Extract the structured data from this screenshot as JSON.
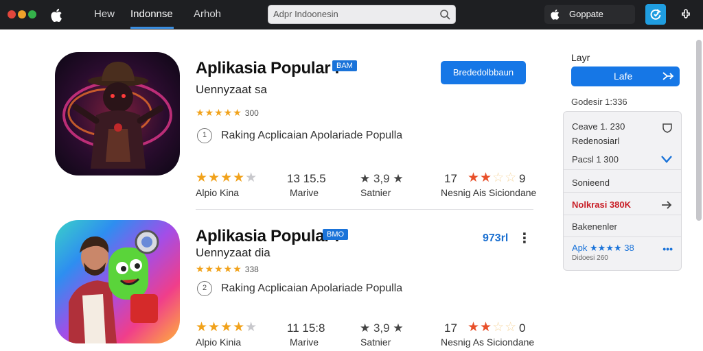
{
  "window": {
    "dots": [
      "#e2463c",
      "#f0a22a",
      "#34b24a"
    ]
  },
  "nav": {
    "items": [
      "Hew",
      "Indonnse",
      "Arhoh"
    ],
    "active": 1
  },
  "search": {
    "value": "Adpr Indoonesin"
  },
  "account": {
    "label": "Goppate"
  },
  "apps": [
    {
      "title": "Aplikasia Popular .",
      "badge": "BAM",
      "subtitle": "Uennyzaat sa",
      "rating_count": "300",
      "rank_icon": "1",
      "rank_text": "Raking Acplicaian Apolariade Populla",
      "stats": [
        {
          "value": "",
          "stars": "★★★★",
          "label": "Alpio Kina"
        },
        {
          "value": "13 15.5",
          "stars": "",
          "label": "Marive"
        },
        {
          "value": "★ 3,9 ★",
          "stars": "",
          "label": "Satnier"
        },
        {
          "value": "17",
          "stars": "★★☆☆",
          "tail": "9",
          "label": "Nesnig Ais  Siciondane"
        }
      ],
      "action": "Brededolbbaun"
    },
    {
      "title": "Aplikasia Popular .",
      "badge": "BMO",
      "subtitle": "Uennyzaat dia",
      "rating_count": "338",
      "rank_icon": "2",
      "rank_text": "Raking Acplicaian Apolariade Populla",
      "stats": [
        {
          "value": "",
          "stars": "★★★★",
          "label": "Alpio Kinia"
        },
        {
          "value": "11 15:8",
          "stars": "",
          "label": "Marive"
        },
        {
          "value": "★ 3,9 ★",
          "stars": "",
          "label": "Satnier"
        },
        {
          "value": "17",
          "stars": "★★☆☆",
          "tail": "0",
          "label": "Nesnig As  Siciondane"
        }
      ],
      "price": "973rl",
      "more": "⋮"
    }
  ],
  "panel": {
    "heading": "Layr",
    "button": "Lafe",
    "sub": "Godesir 1:336",
    "rows": [
      {
        "text": "Ceave 1. 230",
        "icon": "shield-icon"
      },
      {
        "text": "Redenosiarl"
      },
      {
        "text": "Pacsl 1 300",
        "icon": "check-icon"
      },
      {
        "text": "Sonieend"
      },
      {
        "text": "Nolkrasi 380K",
        "icon": "arrow-right-icon"
      },
      {
        "text": "Bakenenler"
      },
      {
        "text": "Apk ★★★★ 38",
        "sub": "Didoesi 260",
        "icon": "ellipsis-icon"
      }
    ]
  }
}
